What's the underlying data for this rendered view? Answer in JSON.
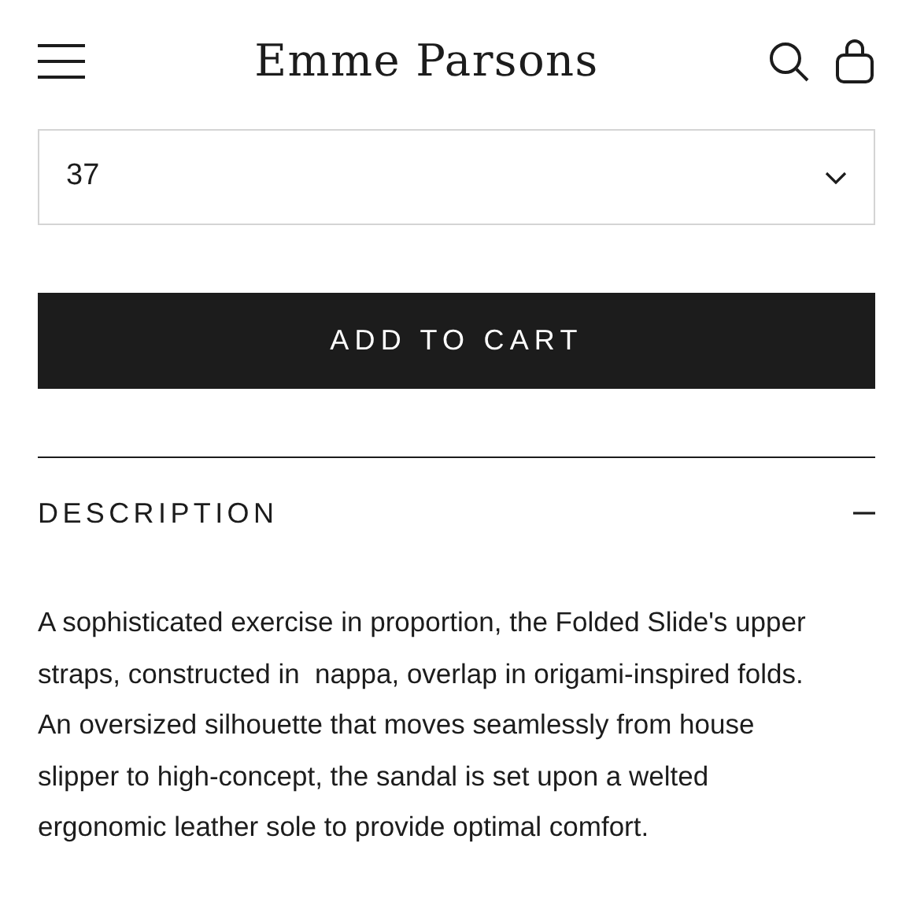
{
  "header": {
    "logo": "Emme Parsons"
  },
  "size_select": {
    "value": "37"
  },
  "add_to_cart": {
    "label": "ADD TO CART"
  },
  "description": {
    "title": "DESCRIPTION",
    "expanded": true,
    "text": "A sophisticated exercise in proportion, the Folded Slide's upper straps, constructed in  nappa, overlap in origami-inspired folds. An oversized silhouette that moves seamlessly from house slipper to high-concept, the sandal is set upon a welted ergonomic leather sole to provide optimal comfort."
  }
}
